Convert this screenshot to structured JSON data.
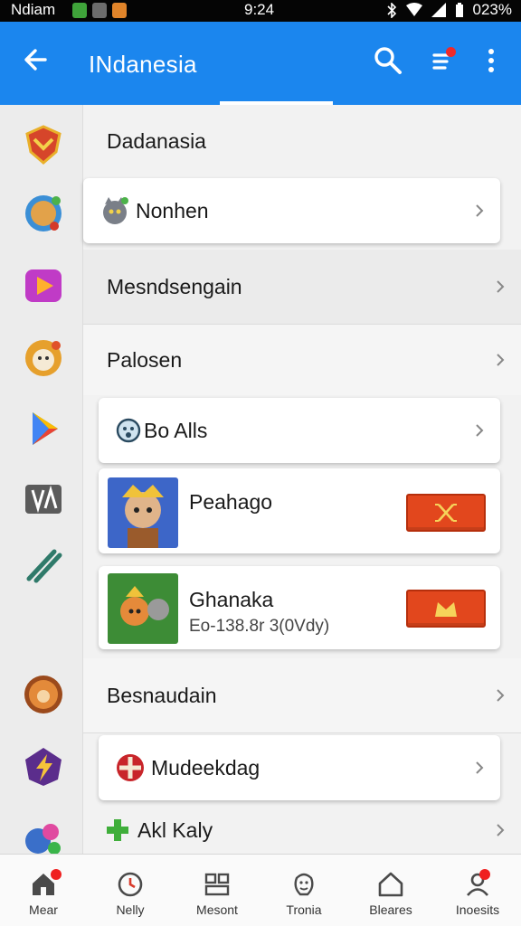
{
  "status_bar": {
    "carrier": "Ndiam",
    "time": "9:24",
    "battery": "023%"
  },
  "app_bar": {
    "title": "INdanesia",
    "icons": [
      "back-arrow-icon",
      "search-icon",
      "filter-icon",
      "more-vert-icon"
    ]
  },
  "left_rail": {
    "icons": [
      "shield-emblem-icon",
      "hero-game-icon",
      "play-video-icon",
      "character-game-icon",
      "play-store-icon",
      "va-logo-icon",
      "slash-logo-icon",
      "fox-game-icon",
      "lightning-badge-icon",
      "bubbles-game-icon"
    ]
  },
  "list": {
    "header": "Dadanasia",
    "items": [
      {
        "label": "Nonhen",
        "icon": "cat-hero-icon"
      },
      {
        "label": "Mesndsengain"
      },
      {
        "label": "Palosen"
      },
      {
        "label": "Bo Alls",
        "icon": "smiley-icon"
      },
      {
        "label": "Besnaudain"
      },
      {
        "label": "Mudeekdag",
        "icon": "red-cross-icon"
      },
      {
        "label": "Akl Kaly",
        "icon": "green-cross-icon"
      }
    ],
    "games": [
      {
        "title": "Peahago",
        "subtitle": "",
        "button_icon": "crossed-swords-icon"
      },
      {
        "title": "Ghanaka",
        "subtitle": "Eo-138.8r 3(0Vdy)",
        "button_icon": "crown-icon"
      }
    ]
  },
  "bottom_nav": {
    "tabs": [
      {
        "label": "Mear",
        "icon": "home-icon",
        "badge": true
      },
      {
        "label": "Nelly",
        "icon": "clock-icon",
        "badge": false
      },
      {
        "label": "Mesont",
        "icon": "grid-icon",
        "badge": false
      },
      {
        "label": "Tronia",
        "icon": "smile-face-icon",
        "badge": false
      },
      {
        "label": "Bleares",
        "icon": "house-icon",
        "badge": false
      },
      {
        "label": "Inoesits",
        "icon": "profile-icon",
        "badge": true
      }
    ]
  },
  "colors": {
    "app_bar": "#1b86ee",
    "accent_button": "#e2471d",
    "badge": "#ef2020"
  }
}
